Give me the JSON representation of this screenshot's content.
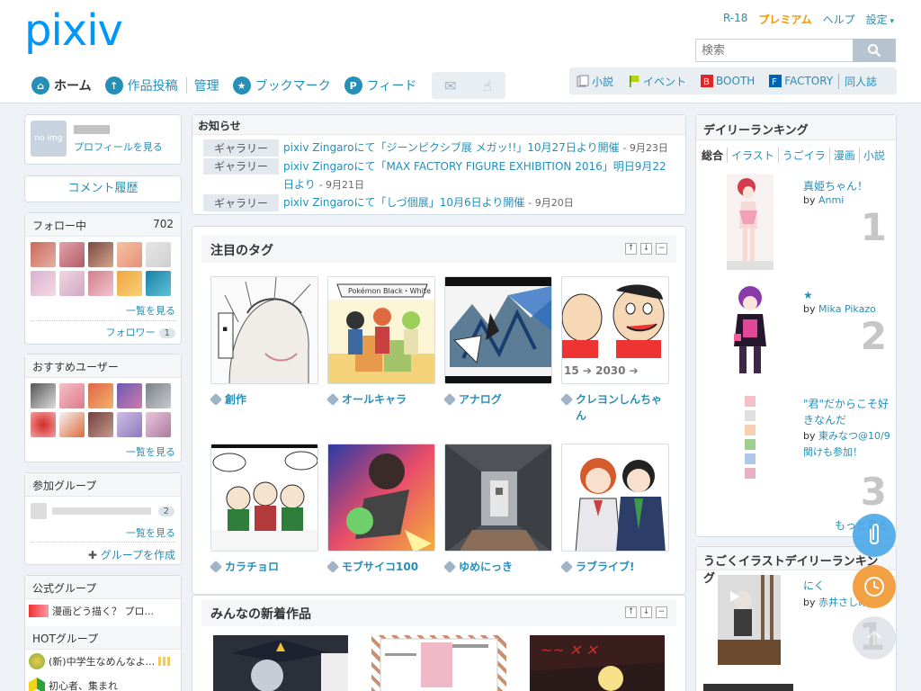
{
  "header": {
    "logo": "pixiv",
    "toplinks": {
      "r18": "R-18",
      "premium": "プレミアム",
      "help": "ヘルプ",
      "settings": "設定"
    },
    "search_placeholder": "検索",
    "nav": [
      {
        "label": "ホーム",
        "icon": "home-icon"
      },
      {
        "label": "作品投稿",
        "icon": "upload-icon"
      },
      {
        "label": "管理",
        "icon": ""
      },
      {
        "label": "ブックマーク",
        "icon": "star-icon"
      },
      {
        "label": "フィード",
        "icon": "feed-icon"
      }
    ],
    "rightnav": [
      "小説",
      "イベント",
      "BOOTH",
      "FACTORY",
      "同人誌"
    ]
  },
  "sidebar": {
    "profile_link": "プロフィールを見る",
    "comment_history": "コメント履歴",
    "follow": {
      "title": "フォロー中",
      "count": "702",
      "more": "一覧を見る",
      "followers": "フォロワー",
      "followers_count": "1"
    },
    "recommend": {
      "title": "おすすめユーザー",
      "more": "一覧を見る"
    },
    "groups": {
      "title": "参加グループ",
      "count": "2",
      "more": "一覧を見る",
      "create": "グループを作成"
    },
    "official": {
      "title": "公式グループ",
      "item": "漫画どう描く？ プロ...",
      "hot_title": "HOTグループ",
      "hot1": "(新)中学生なめんなよ...",
      "hot2": "初心者、集まれ"
    }
  },
  "news": {
    "title": "お知らせ",
    "items": [
      {
        "tag": "ギャラリー",
        "text": "pixiv Zingaroにて「ジーンピクシブ展 メガッ!!」10月27日より開催",
        "date": "- 9月23日"
      },
      {
        "tag": "ギャラリー",
        "text": "pixiv Zingaroにて「MAX FACTORY FIGURE EXHIBITION 2016」明日9月22日より",
        "date": "- 9月21日"
      },
      {
        "tag": "ギャラリー",
        "text": "pixiv Zingaroにて「しづ個展」10月6日より開催",
        "date": "- 9月20日"
      }
    ]
  },
  "tags": {
    "title": "注目のタグ",
    "items": [
      "創作",
      "オールキャラ",
      "アナログ",
      "クレヨンしんちゃん",
      "カラチョロ",
      "モブサイコ100",
      "ゆめにっき",
      "ラブライブ!"
    ],
    "image_texts": {
      "pokemon": "Pokémon Black・White",
      "years": "15 ➔ 2030 ➔"
    }
  },
  "new_works": {
    "title": "みんなの新着作品"
  },
  "ranking": {
    "title": "デイリーランキング",
    "tabs": [
      "総合",
      "イラスト",
      "うごイラ",
      "漫画",
      "小説"
    ],
    "items": [
      {
        "rank": "1",
        "title": "真姫ちゃん！",
        "by": "by",
        "author": "Anmi"
      },
      {
        "rank": "2",
        "title": "★",
        "by": "by",
        "author": "Mika Pikazo"
      },
      {
        "rank": "3",
        "title": "\"君\"だからこそ好きなんだ",
        "by": "by",
        "author": "東みなつ@10/9関けも参加！"
      }
    ],
    "more": "もっと見る"
  },
  "ugoira": {
    "title": "うごくイラストデイリーランキング",
    "items": [
      {
        "rank": "1",
        "title": "にく",
        "by": "by",
        "author": "赤井さしみ"
      }
    ]
  }
}
